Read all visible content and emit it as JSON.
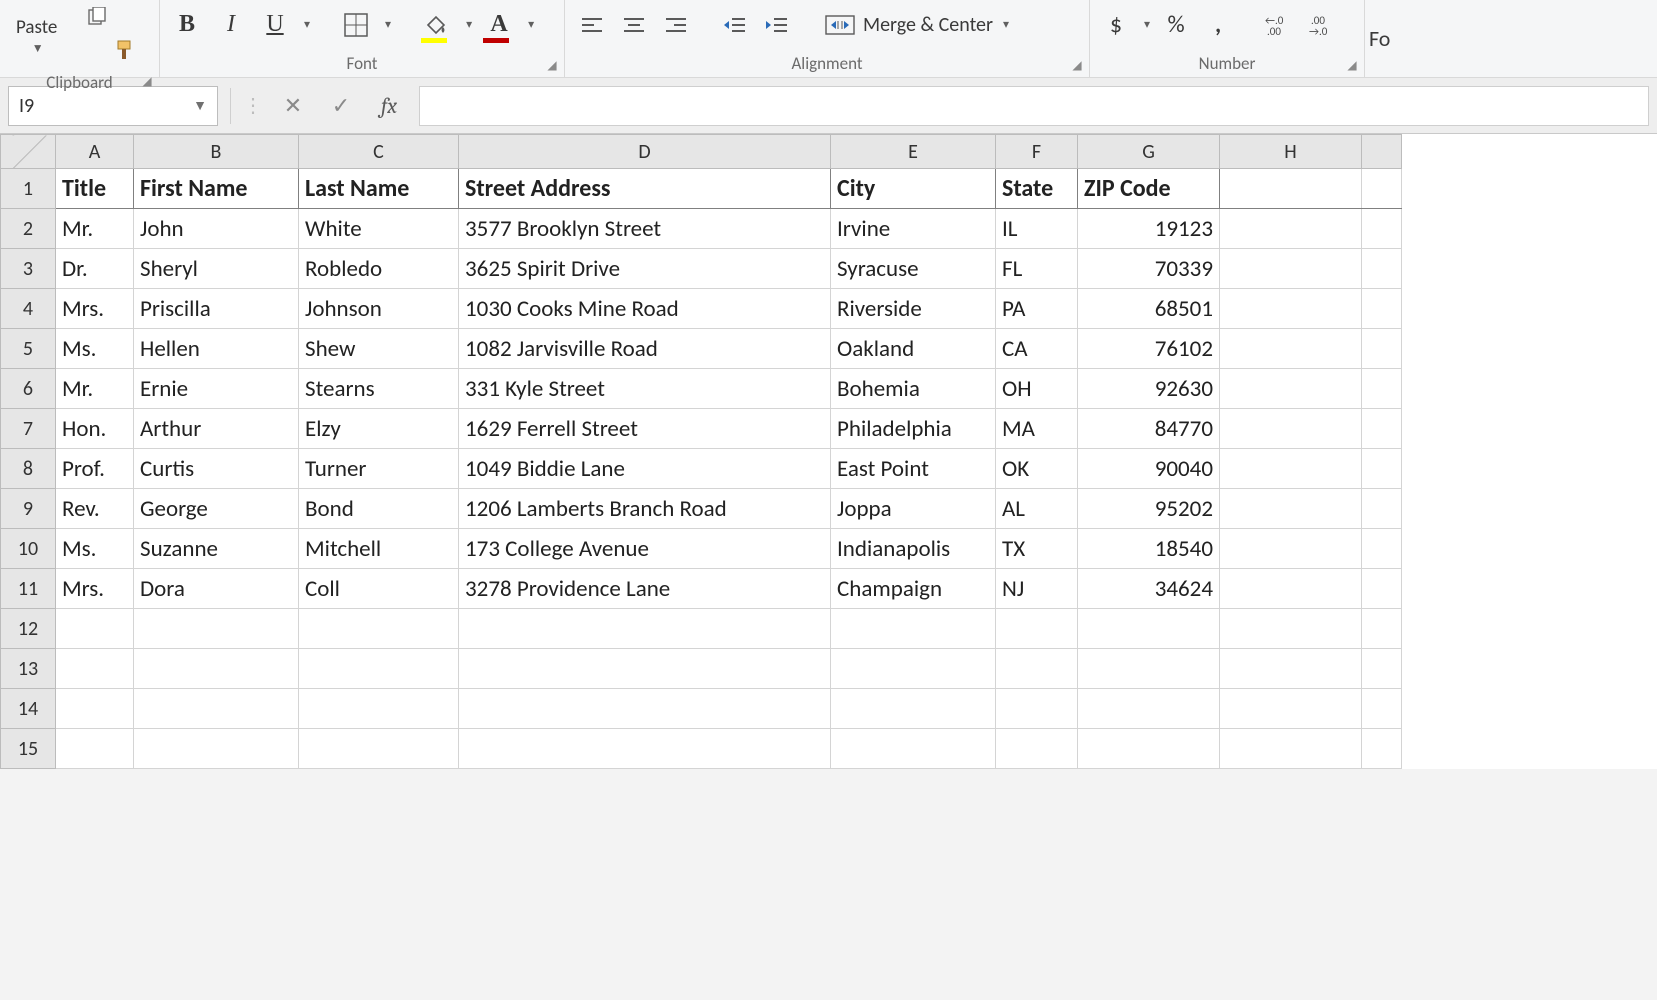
{
  "ribbon": {
    "paste_label": "Paste",
    "groups": {
      "clipboard": "Clipboard",
      "font": "Font",
      "alignment": "Alignment",
      "number": "Number"
    },
    "merge_center": "Merge & Center",
    "currency": "$",
    "percent": "%",
    "comma": ",",
    "truncated_right": "Fo"
  },
  "formula_bar": {
    "namebox_value": "I9",
    "fx_label": "fx",
    "formula_value": ""
  },
  "column_letters": [
    "A",
    "B",
    "C",
    "D",
    "E",
    "F",
    "G",
    "H"
  ],
  "row_numbers_extra": [
    12,
    13,
    14,
    15
  ],
  "table": {
    "headers": [
      "Title",
      "First Name",
      "Last Name",
      "Street Address",
      "City",
      "State",
      "ZIP Code"
    ],
    "rows": [
      {
        "n": 2,
        "title": "Mr.",
        "first": "John",
        "last": "White",
        "street": "3577 Brooklyn Street",
        "city": "Irvine",
        "state": "IL",
        "zip": "19123"
      },
      {
        "n": 3,
        "title": "Dr.",
        "first": "Sheryl",
        "last": "Robledo",
        "street": "3625 Spirit Drive",
        "city": "Syracuse",
        "state": "FL",
        "zip": "70339"
      },
      {
        "n": 4,
        "title": "Mrs.",
        "first": "Priscilla",
        "last": "Johnson",
        "street": "1030 Cooks Mine Road",
        "city": "Riverside",
        "state": "PA",
        "zip": "68501"
      },
      {
        "n": 5,
        "title": "Ms.",
        "first": "Hellen",
        "last": "Shew",
        "street": "1082 Jarvisville Road",
        "city": "Oakland",
        "state": "CA",
        "zip": "76102"
      },
      {
        "n": 6,
        "title": "Mr.",
        "first": "Ernie",
        "last": "Stearns",
        "street": "331 Kyle Street",
        "city": "Bohemia",
        "state": "OH",
        "zip": "92630"
      },
      {
        "n": 7,
        "title": "Hon.",
        "first": "Arthur",
        "last": "Elzy",
        "street": "1629 Ferrell Street",
        "city": "Philadelphia",
        "state": "MA",
        "zip": "84770"
      },
      {
        "n": 8,
        "title": "Prof.",
        "first": "Curtis",
        "last": "Turner",
        "street": "1049 Biddie Lane",
        "city": "East Point",
        "state": "OK",
        "zip": "90040"
      },
      {
        "n": 9,
        "title": "Rev.",
        "first": "George",
        "last": "Bond",
        "street": "1206 Lamberts Branch Road",
        "city": "Joppa",
        "state": "AL",
        "zip": "95202"
      },
      {
        "n": 10,
        "title": "Ms.",
        "first": "Suzanne",
        "last": "Mitchell",
        "street": "173 College Avenue",
        "city": "Indianapolis",
        "state": "TX",
        "zip": "18540"
      },
      {
        "n": 11,
        "title": "Mrs.",
        "first": "Dora",
        "last": "Coll",
        "street": "3278 Providence Lane",
        "city": "Champaign",
        "state": "NJ",
        "zip": "34624"
      }
    ]
  },
  "chart_data": {
    "type": "table",
    "title": "",
    "columns": [
      "Title",
      "First Name",
      "Last Name",
      "Street Address",
      "City",
      "State",
      "ZIP Code"
    ],
    "rows": [
      [
        "Mr.",
        "John",
        "White",
        "3577 Brooklyn Street",
        "Irvine",
        "IL",
        19123
      ],
      [
        "Dr.",
        "Sheryl",
        "Robledo",
        "3625 Spirit Drive",
        "Syracuse",
        "FL",
        70339
      ],
      [
        "Mrs.",
        "Priscilla",
        "Johnson",
        "1030 Cooks Mine Road",
        "Riverside",
        "PA",
        68501
      ],
      [
        "Ms.",
        "Hellen",
        "Shew",
        "1082 Jarvisville Road",
        "Oakland",
        "CA",
        76102
      ],
      [
        "Mr.",
        "Ernie",
        "Stearns",
        "331 Kyle Street",
        "Bohemia",
        "OH",
        92630
      ],
      [
        "Hon.",
        "Arthur",
        "Elzy",
        "1629 Ferrell Street",
        "Philadelphia",
        "MA",
        84770
      ],
      [
        "Prof.",
        "Curtis",
        "Turner",
        "1049 Biddie Lane",
        "East Point",
        "OK",
        90040
      ],
      [
        "Rev.",
        "George",
        "Bond",
        "1206 Lamberts Branch Road",
        "Joppa",
        "AL",
        95202
      ],
      [
        "Ms.",
        "Suzanne",
        "Mitchell",
        "173 College Avenue",
        "Indianapolis",
        "TX",
        18540
      ],
      [
        "Mrs.",
        "Dora",
        "Coll",
        "3278 Providence Lane",
        "Champaign",
        "NJ",
        34624
      ]
    ]
  }
}
